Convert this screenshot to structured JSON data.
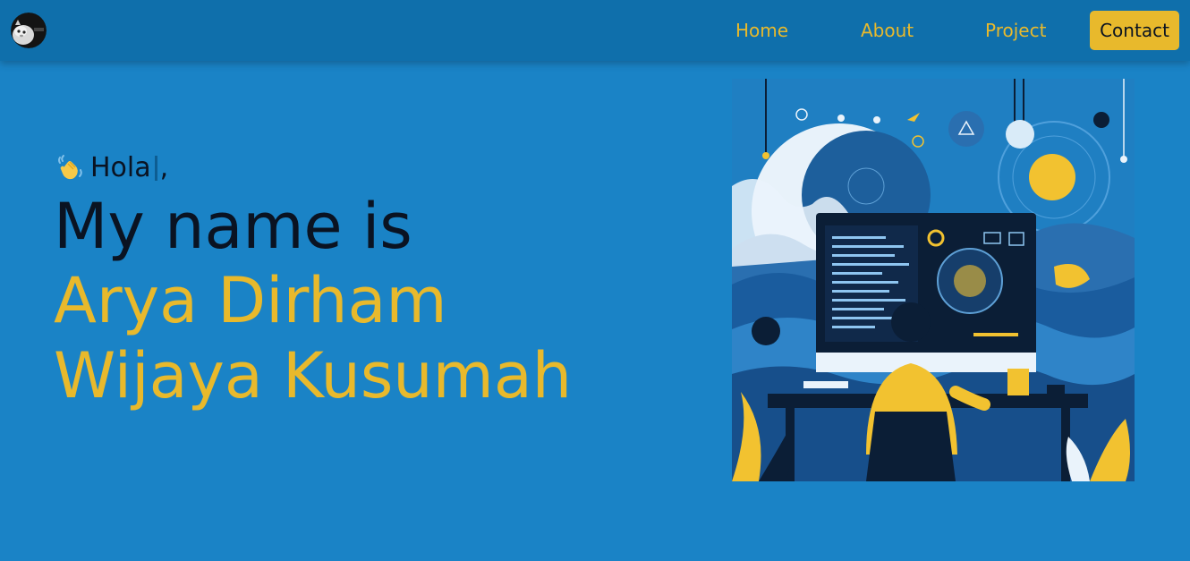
{
  "nav": {
    "avatar_icon": "profile-avatar-icon",
    "links": [
      {
        "label": "Home"
      },
      {
        "label": "About"
      },
      {
        "label": "Project"
      }
    ],
    "contact_label": "Contact"
  },
  "hero": {
    "wave_icon": "waving-hand-icon",
    "greeting": "Hola",
    "greeting_suffix": ",",
    "intro": "My name is",
    "name_line_1": "Arya Dirham",
    "name_line_2": "Wijaya Kusumah",
    "illustration": "developer-at-computer-illustration"
  },
  "colors": {
    "page_background": "#1a83c6",
    "navbar_background": "#0f6fab",
    "accent": "#e8b92c",
    "text_dark": "#0a1322"
  }
}
